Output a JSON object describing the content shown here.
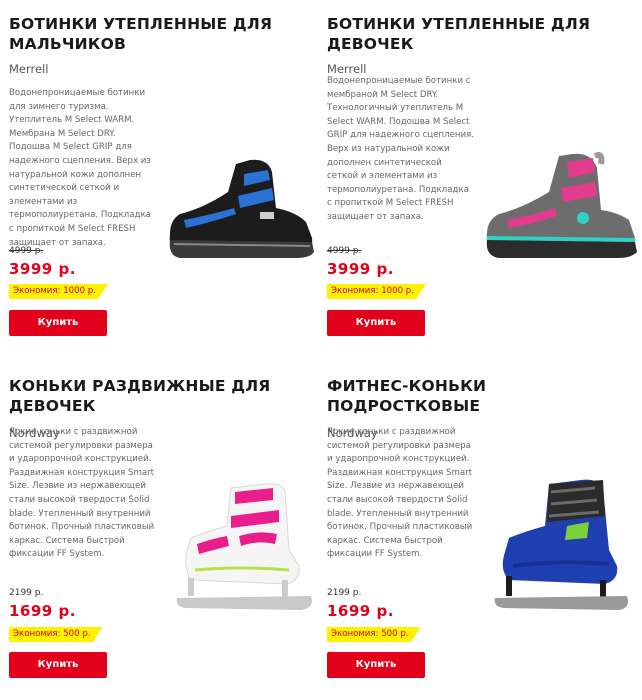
{
  "products": [
    {
      "title_line1": "БОТИНКИ УТЕПЛЕННЫЕ ДЛЯ",
      "title_line2": "МАЛЬЧИКОВ",
      "brand": "Merrell",
      "description": "Водонепроницаемые ботинки для зимнего туризма. Утеплитель M Select WARM. Мембрана M Select DRY. Подошва M Select GRIP для надежного сцепления. Верх из натуральной кожи дополнен синтетической сеткой и элементами из термополиуретана. Подкладка с пропиткой M Select FRESH защищает от запаха.",
      "old_price": "4999 р.",
      "price": "3999 р.",
      "savings": "Экономия: 1000 р.",
      "buy_label": "Купить",
      "image_icon": "boy-winter-boot-icon"
    },
    {
      "title_line1": "БОТИНКИ УТЕПЛЕННЫЕ ДЛЯ ДЕВОЧЕК",
      "title_line2": "",
      "brand": "Merrell",
      "description": "Водонепроницаемые ботинки с мембраной M Select DRY. Технологичный утеплитель M Select WARM. Подошва M Select GRIP для надежного сцепления. Верх из натуральной кожи дополнен синтетической сеткой и элементами из термополиуретана. Подкладка с пропиткой M Select FRESH защищает от запаха.",
      "old_price": "4999 р.",
      "price": "3999 р.",
      "savings": "Экономия: 1000 р.",
      "buy_label": "Купить",
      "image_icon": "girl-winter-boot-icon"
    },
    {
      "title_line1": "КОНЬКИ РАЗДВИЖНЫЕ ДЛЯ ДЕВОЧЕК",
      "title_line2": "",
      "brand": "Nordway",
      "description": "Яркие коньки с раздвижной системой регулировки размера и ударопрочной конструкцией. Раздвижная конструкция Smart Size. Лезвие из нержавеющей стали высокой твердости Solid blade. Утепленный внутренний ботинок. Прочный пластиковый каркас. Система быстрой фиксации FF System.",
      "old_price": "2199 р.",
      "price": "1699 р.",
      "savings": "Экономия: 500 р.",
      "buy_label": "Купить",
      "image_icon": "girl-ice-skate-icon"
    },
    {
      "title_line1": "ФИТНЕС-КОНЬКИ ПОДРОСТКОВЫЕ",
      "title_line2": "",
      "brand": "Nordway",
      "description": "Яркие коньки с раздвижной системой регулировки размера и ударопрочной конструкцией. Раздвижная конструкция Smart Size. Лезвие из нержавеющей стали высокой твердости Solid blade. Утепленный внутренний ботинок. Прочный пластиковый каркас. Система быстрой фиксации FF System.",
      "old_price": "2199 р.",
      "price": "1699 р.",
      "savings": "Экономия: 500 р.",
      "buy_label": "Купить",
      "image_icon": "fitness-skate-icon"
    }
  ],
  "colors": {
    "accent_red": "#e3001b",
    "savings_yellow": "#fff200"
  }
}
